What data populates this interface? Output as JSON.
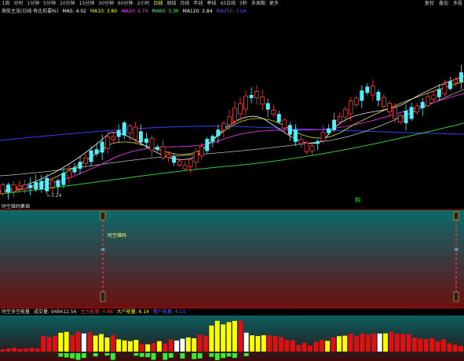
{
  "toolbar": {
    "timeframes": [
      "1周",
      "分时",
      "1分钟",
      "5分钟",
      "10分钟",
      "15分钟",
      "30分钟",
      "60分钟",
      "2小时",
      "日线",
      "周线",
      "月线",
      "年线",
      "季线",
      "45日线",
      "5秒",
      "多周期",
      "更多"
    ],
    "active_index": 9,
    "right_items": [
      "复权",
      "叠加",
      "多股"
    ]
  },
  "main_panel": {
    "indicator_title": "美航主涨(日线·寿比前要标)",
    "ma_legend": [
      {
        "label": "MA5: 4.02",
        "color": "#ffffff"
      },
      {
        "label": "MA10: 3.80",
        "color": "#ffff00"
      },
      {
        "label": "MA20: 3.74",
        "color": "#ff44ff"
      },
      {
        "label": "MA60: 3.30",
        "color": "#55ff55"
      },
      {
        "label": "MA120: 2.84",
        "color": "#ffffff"
      },
      {
        "label": "MA250: 3.04",
        "color": "#5555ff"
      }
    ],
    "low_price_label": "←3.24",
    "marker_text": "购"
  },
  "middle_panel": {
    "title": "时空维码集锦",
    "signal_text": "时空维码"
  },
  "bottom_panel": {
    "title": "时空多空能量",
    "fields": [
      {
        "label": "成交量: 948412.56",
        "color": "#dddddd"
      },
      {
        "label": "主力能量: 4.88",
        "color": "#ff3333"
      },
      {
        "label": "大户能量: 6.14",
        "color": "#ffff00"
      },
      {
        "label": "散户能量: 4.11",
        "color": "#4466ff"
      }
    ]
  },
  "colors": {
    "up": "#ff3b3b",
    "down": "#4ff0ff",
    "energy_red": "#e01010",
    "energy_yellow": "#ffff00",
    "energy_white": "#ffffff",
    "energy_green": "#33ee33"
  }
}
